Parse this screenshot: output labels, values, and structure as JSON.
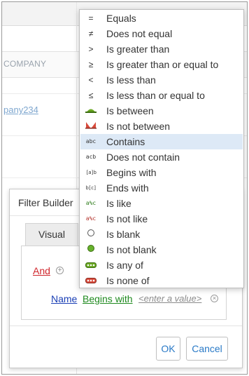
{
  "grid": {
    "column_header": "COMPANY",
    "cell_link": "pany234"
  },
  "dialog": {
    "title": "Filter Builder",
    "tab_visual": "Visual",
    "group_operator": "And",
    "condition": {
      "field": "Name",
      "operator": "Begins with",
      "value_placeholder": "<enter a value>"
    },
    "ok_label": "OK",
    "cancel_label": "Cancel"
  },
  "operator_menu": {
    "selected": "Contains",
    "items": [
      {
        "label": "Equals",
        "icon": "equals-icon"
      },
      {
        "label": "Does not equal",
        "icon": "not-equal-icon"
      },
      {
        "label": "Is greater than",
        "icon": "greater-than-icon"
      },
      {
        "label": "Is greater than or equal to",
        "icon": "greater-or-equal-icon"
      },
      {
        "label": "Is less than",
        "icon": "less-than-icon"
      },
      {
        "label": "Is less than or equal to",
        "icon": "less-or-equal-icon"
      },
      {
        "label": "Is between",
        "icon": "between-icon"
      },
      {
        "label": "Is not between",
        "icon": "not-between-icon"
      },
      {
        "label": "Contains",
        "icon": "contains-icon"
      },
      {
        "label": "Does not contain",
        "icon": "not-contains-icon"
      },
      {
        "label": "Begins with",
        "icon": "begins-with-icon"
      },
      {
        "label": "Ends with",
        "icon": "ends-with-icon"
      },
      {
        "label": "Is like",
        "icon": "like-icon"
      },
      {
        "label": "Is not like",
        "icon": "not-like-icon"
      },
      {
        "label": "Is blank",
        "icon": "blank-icon"
      },
      {
        "label": "Is not blank",
        "icon": "not-blank-icon"
      },
      {
        "label": "Is any of",
        "icon": "any-of-icon"
      },
      {
        "label": "Is none of",
        "icon": "none-of-icon"
      }
    ]
  },
  "colors": {
    "group_operator": "#d0262c",
    "field": "#1a3fb5",
    "operator": "#1f8a1f",
    "button_text": "#2a7ac7",
    "selected_row": "#dde9f6"
  }
}
